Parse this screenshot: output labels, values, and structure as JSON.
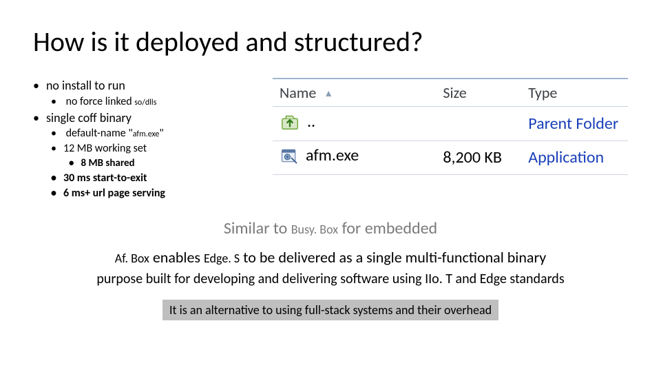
{
  "title": "How is it deployed and structured?",
  "bullets": {
    "l1a": "no install to run",
    "l2a_pre": "no force linked ",
    "l2a_small": "so/dlls",
    "l1b": "single coff binary",
    "l2b_pre": "default-name \"",
    "l2b_small": "afm.exe",
    "l2b_post": "\"",
    "l2c": "12 MB working set",
    "l3a": "8 MB shared",
    "l2d": "30 ms start-to-exit",
    "l2e": "6 ms+ url page serving"
  },
  "table": {
    "headers": {
      "name": "Name",
      "size": "Size",
      "type": "Type"
    },
    "rows": [
      {
        "name": "..",
        "size": "",
        "type": "Parent Folder",
        "icon": "up"
      },
      {
        "name": "afm.exe",
        "size": "8,200 KB",
        "type": "Application",
        "icon": "exe"
      }
    ]
  },
  "similar_pre": "Similar to ",
  "similar_bb": "Busy. Box",
  "similar_post": " for embedded",
  "enable_af": "Af. Box",
  "enable_mid1": " enables ",
  "enable_es": "Edge. S",
  "enable_mid2": " to be delivered as a single multi-functional binary",
  "purpose": "purpose built for developing and delivering software using IIo. T and Edge standards",
  "alt": "It is an alternative to using full-stack systems and their overhead"
}
